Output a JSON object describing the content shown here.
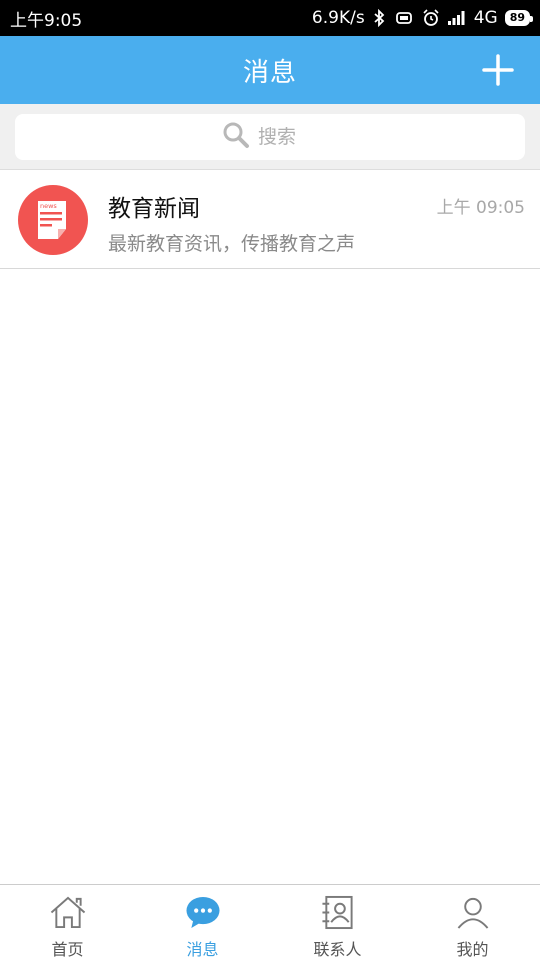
{
  "status_bar": {
    "time": "上午9:05",
    "speed": "6.9K/s",
    "network": "4G",
    "battery": "89"
  },
  "header": {
    "title": "消息"
  },
  "search": {
    "placeholder": "搜索"
  },
  "messages": [
    {
      "title": "教育新闻",
      "time": "上午 09:05",
      "preview": "最新教育资讯，传播教育之声",
      "avatar_icon": "news-icon",
      "avatar_text": "news"
    }
  ],
  "tabs": [
    {
      "label": "首页",
      "icon": "home-icon"
    },
    {
      "label": "消息",
      "icon": "chat-bubble-icon"
    },
    {
      "label": "联系人",
      "icon": "contacts-icon"
    },
    {
      "label": "我的",
      "icon": "person-icon"
    }
  ],
  "colors": {
    "primary": "#4aaeee",
    "active_tab": "#3a9fe0",
    "avatar_bg": "#f15451"
  }
}
